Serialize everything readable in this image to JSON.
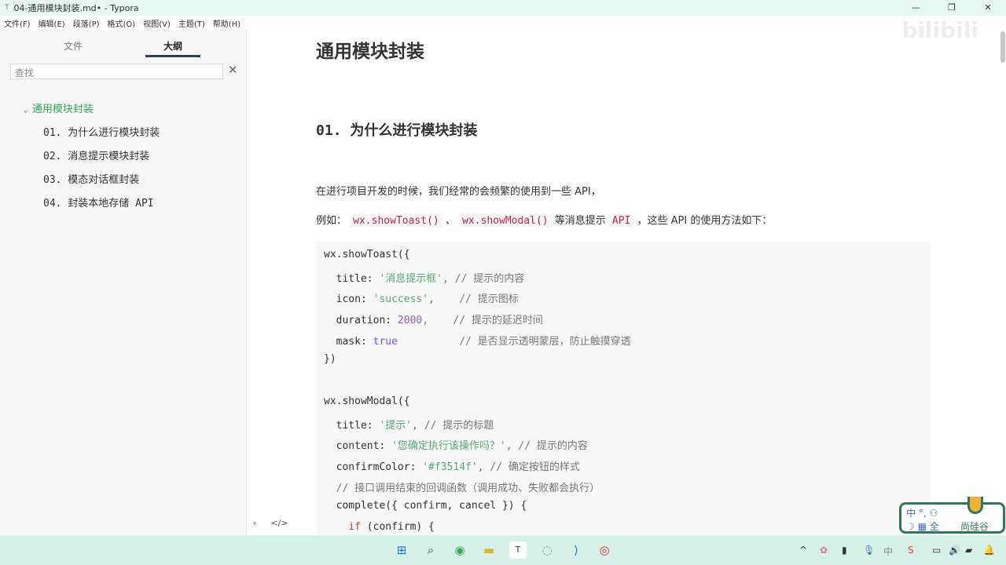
{
  "window": {
    "title": "04-通用模块封装.md• - Typora",
    "minimize": "—",
    "maximize": "❐",
    "close": "✕"
  },
  "menu": [
    "文件(F)",
    "编辑(E)",
    "段落(P)",
    "格式(O)",
    "视图(V)",
    "主题(T)",
    "帮助(H)"
  ],
  "sidebar": {
    "tabs": [
      "文件",
      "大纲"
    ],
    "search_placeholder": "查找",
    "outline": [
      "通用模块封装",
      "01. 为什么进行模块封装",
      "02. 消息提示模块封装",
      "03. 模态对话框封装",
      "04. 封装本地存储 API"
    ]
  },
  "doc": {
    "h1": "通用模块封装",
    "h2": "01. 为什么进行模块封装",
    "p1": "在进行项目开发的时候，我们经常的会频繁的使用到一些 API，",
    "p2_a": "例如：",
    "p2_code1": "wx.showToast()",
    "p2_sep": "、",
    "p2_code2": "wx.showModal()",
    "p2_b": "等消息提示",
    "p2_code3": "API",
    "p2_c": "，这些 API 的使用方法如下：",
    "code": {
      "l1": "wx.showToast({",
      "l2k": "  title: ",
      "l2s": "'消息提示框'",
      "l2c": ", // 提示的内容",
      "l3k": "  icon: ",
      "l3s": "'success'",
      "l3c": ",    // 提示图标",
      "l4k": "  duration: ",
      "l4n": "2000",
      "l4c": ",    // 提示的延迟时间",
      "l5k": "  mask: ",
      "l5n": "true",
      "l5c": "          // 是否显示透明蒙层，防止触摸穿透",
      "l6": "})",
      "l8": "wx.showModal({",
      "l9k": "  title: ",
      "l9s": "'提示'",
      "l9c": ", // 提示的标题",
      "l10k": "  content: ",
      "l10s": "'您确定执行该操作吗？'",
      "l10c": ", // 提示的内容",
      "l11k": "  confirmColor: ",
      "l11s": "'#f3514f'",
      "l11c": ", // 确定按钮的样式",
      "l12": "  // 接口调用结束的回调函数（调用成功、失败都会执行）",
      "l13": "  complete({ confirm, cancel }) {",
      "l14a": "    ",
      "l14k": "if",
      "l14b": " (confirm) {"
    }
  },
  "watermark": "bilibili",
  "ime": {
    "line1": "中 °, ⚇",
    "line2": "☽ ▦ 全",
    "brand": "尚硅谷"
  },
  "footer": {
    "left": "‹",
    "right": "</>"
  }
}
